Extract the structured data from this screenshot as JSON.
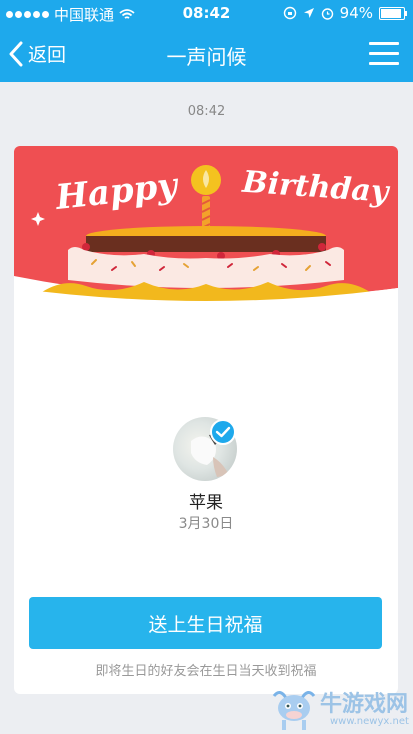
{
  "status_bar": {
    "carrier": "中国联通",
    "time": "08:42",
    "battery": "94%",
    "icons": [
      "signal-dots",
      "wifi-icon",
      "rotation-lock-icon",
      "location-icon",
      "alarm-icon",
      "battery-icon"
    ]
  },
  "nav": {
    "back_label": "返回",
    "title": "一声问候",
    "menu_icon": "menu-icon"
  },
  "message_time": "08:42",
  "card": {
    "banner": {
      "happy_text": "Happy",
      "birthday_text": "Birthday",
      "background_color": "#ef4f52"
    },
    "profile": {
      "name": "苹果",
      "birthday": "3月30日",
      "verified_icon": "check-badge-icon"
    },
    "send_button_label": "送上生日祝福",
    "hint": "即将生日的好友会在生日当天收到祝福"
  },
  "watermark": {
    "text": "牛游戏网",
    "url": "www.newyx.net"
  },
  "colors": {
    "accent": "#1ea9ec",
    "button": "#27b4ec",
    "page_bg": "#eceef2"
  }
}
